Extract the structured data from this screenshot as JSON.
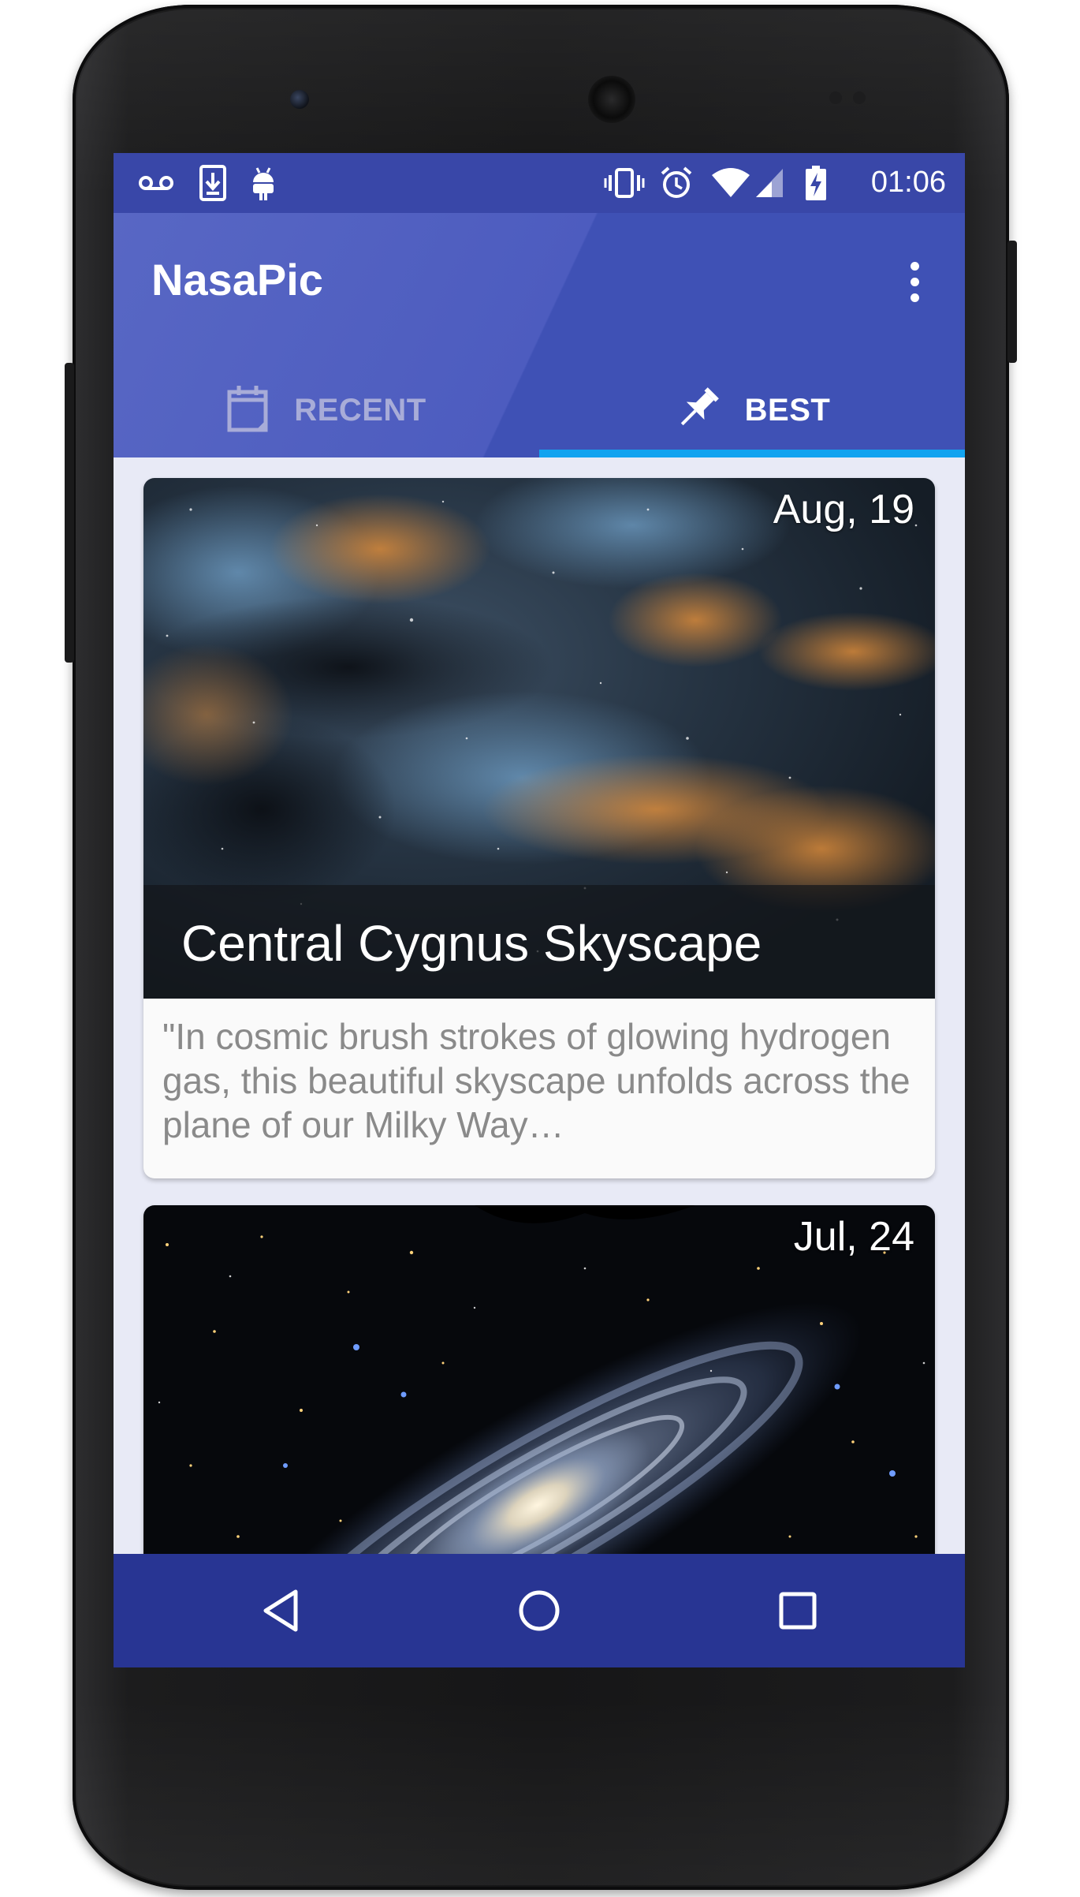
{
  "status_bar": {
    "time": "01:06",
    "left_icons": [
      "voicemail-icon",
      "download-icon",
      "android-icon"
    ],
    "right_icons": [
      "vibrate-icon",
      "alarm-icon",
      "wifi-icon",
      "signal-icon",
      "battery-charging-icon"
    ]
  },
  "app_bar": {
    "title": "NasaPic",
    "menu_icon": "more-vert-icon",
    "colors": {
      "primary": "#3f51b5",
      "primary_dark": "#283593",
      "accent": "#12a3f0"
    }
  },
  "tabs": [
    {
      "label": "RECENT",
      "icon": "calendar-icon",
      "selected": false
    },
    {
      "label": "BEST",
      "icon": "pin-icon",
      "selected": true
    }
  ],
  "cards": [
    {
      "date": "Aug, 19",
      "title": "Central Cygnus Skyscape",
      "description": "\"In cosmic brush strokes of glowing hydrogen gas, this beautiful skyscape unfolds across the plane of our Milky Way…"
    },
    {
      "date": "Jul, 24"
    }
  ],
  "nav_bar": {
    "buttons": [
      "back-icon",
      "home-icon",
      "recents-icon"
    ]
  }
}
